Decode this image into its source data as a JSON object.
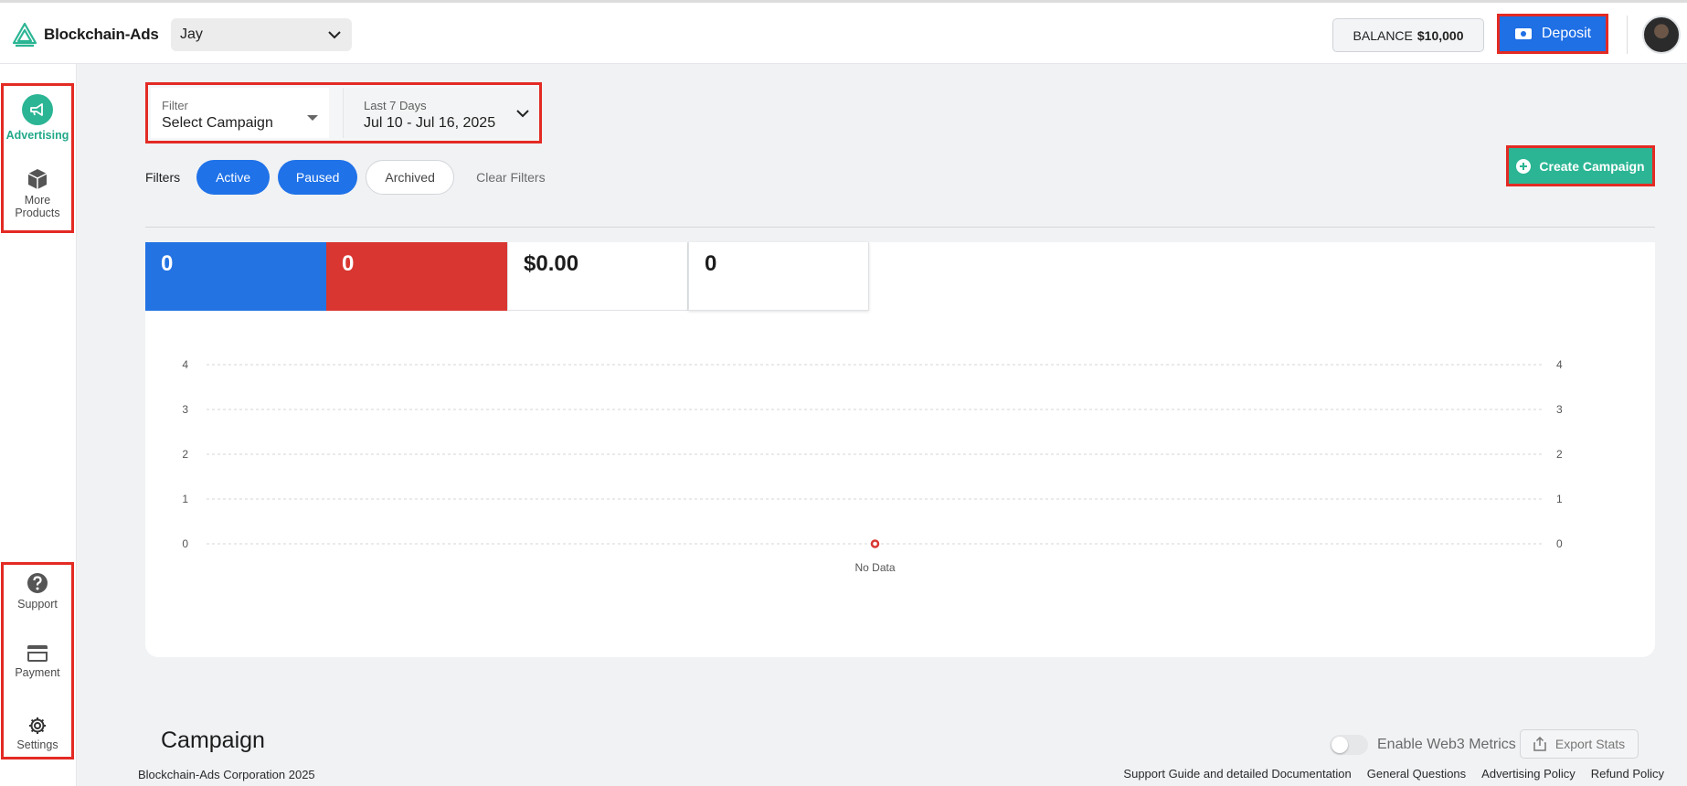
{
  "brand": {
    "name": "Blockchain-Ads"
  },
  "header": {
    "account_name": "Jay",
    "balance_label": "BALANCE",
    "balance_value": "$10,000",
    "deposit_label": "Deposit"
  },
  "sidebar": {
    "top_items": [
      {
        "label": "Advertising",
        "icon": "megaphone-icon",
        "active": true
      },
      {
        "label": "More Products",
        "icon": "cube-icon"
      }
    ],
    "bottom_items": [
      {
        "label": "Support",
        "icon": "help-icon"
      },
      {
        "label": "Payment",
        "icon": "credit-card-icon"
      },
      {
        "label": "Settings",
        "icon": "gear-icon"
      }
    ]
  },
  "filter": {
    "campaign_label": "Filter",
    "campaign_value": "Select Campaign",
    "date_label": "Last 7 Days",
    "date_value": "Jul 10 - Jul 16, 2025"
  },
  "filters_bar": {
    "label": "Filters",
    "chips": [
      "Active",
      "Paused",
      "Archived"
    ],
    "clear_label": "Clear Filters"
  },
  "create_campaign_label": "Create Campaign",
  "stats": [
    "0",
    "0",
    "$0.00",
    "0"
  ],
  "chart_data": {
    "type": "line",
    "y_ticks_left": [
      "4",
      "3",
      "2",
      "1",
      "0"
    ],
    "y_ticks_right": [
      "4",
      "3",
      "2",
      "1",
      "0"
    ],
    "ylim": [
      0,
      4
    ],
    "grid": true,
    "series": [],
    "empty_label": "No Data"
  },
  "campaign_section": {
    "title": "Campaign",
    "web3_label": "Enable Web3 Metrics",
    "export_label": "Export Stats"
  },
  "footer": {
    "copyright": "Blockchain-Ads Corporation 2025",
    "links": [
      "Support Guide and detailed Documentation",
      "General Questions",
      "Advertising Policy",
      "Refund Policy"
    ]
  },
  "colors": {
    "accent_green": "#2bb594",
    "accent_blue": "#1f72e8",
    "accent_red": "#d93631",
    "highlight_border": "#e32b24"
  }
}
